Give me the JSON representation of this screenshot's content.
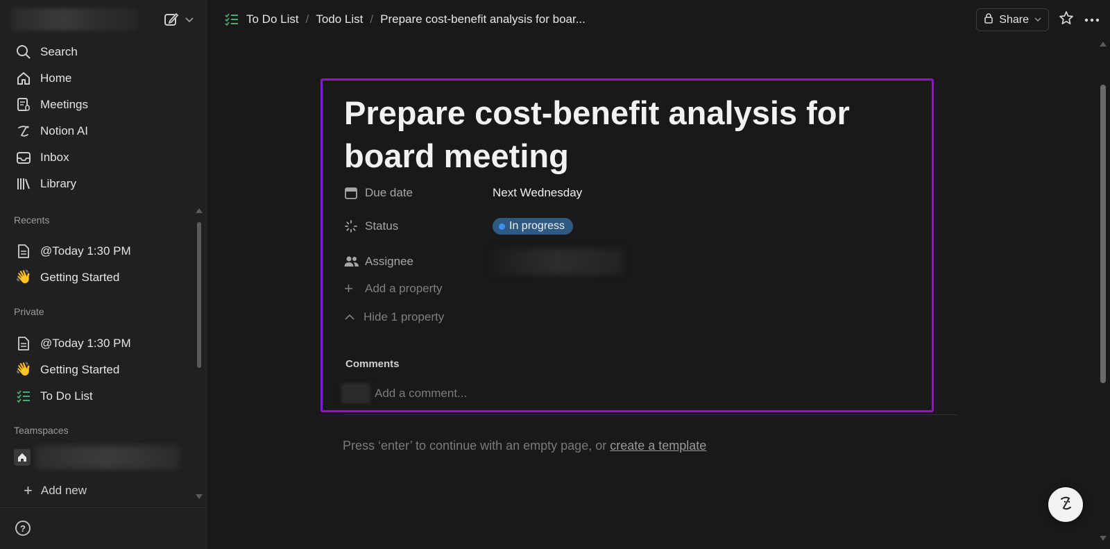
{
  "sidebar": {
    "nav": [
      {
        "label": "Search",
        "icon": "search-icon"
      },
      {
        "label": "Home",
        "icon": "home-icon"
      },
      {
        "label": "Meetings",
        "icon": "meetings-icon"
      },
      {
        "label": "Notion AI",
        "icon": "notion-ai-icon"
      },
      {
        "label": "Inbox",
        "icon": "inbox-icon"
      },
      {
        "label": "Library",
        "icon": "library-icon"
      }
    ],
    "recents_label": "Recents",
    "recents": [
      {
        "label": "@Today 1:30 PM",
        "icon": "page-icon"
      },
      {
        "label": "Getting Started",
        "icon": "👋"
      }
    ],
    "private_label": "Private",
    "private": [
      {
        "label": "@Today 1:30 PM",
        "icon": "page-icon"
      },
      {
        "label": "Getting Started",
        "icon": "👋"
      },
      {
        "label": "To Do List",
        "icon": "checklist-icon"
      }
    ],
    "teamspaces_label": "Teamspaces",
    "add_new": "Add new",
    "help": "?"
  },
  "breadcrumb": {
    "items": [
      "To Do List",
      "Todo List",
      "Prepare cost-benefit analysis for boar..."
    ],
    "separator": "/"
  },
  "topbar": {
    "share_label": "Share"
  },
  "page": {
    "title": "Prepare cost-benefit analysis for board meeting",
    "properties": {
      "due_date": {
        "name": "Due date",
        "value": "Next Wednesday"
      },
      "status": {
        "name": "Status",
        "value": "In progress",
        "color": "#2e5983",
        "dot": "#3d8ff2"
      },
      "assignee": {
        "name": "Assignee"
      }
    },
    "add_property": "Add a property",
    "hide_property": "Hide 1 property",
    "comments_label": "Comments",
    "comment_placeholder": "Add a comment...",
    "hint_prefix": "Press ‘enter’ to continue with an empty page, or ",
    "hint_link": "create a template"
  },
  "colors": {
    "accent_highlight": "#8a14d8",
    "checklist_green": "#4daa74"
  }
}
